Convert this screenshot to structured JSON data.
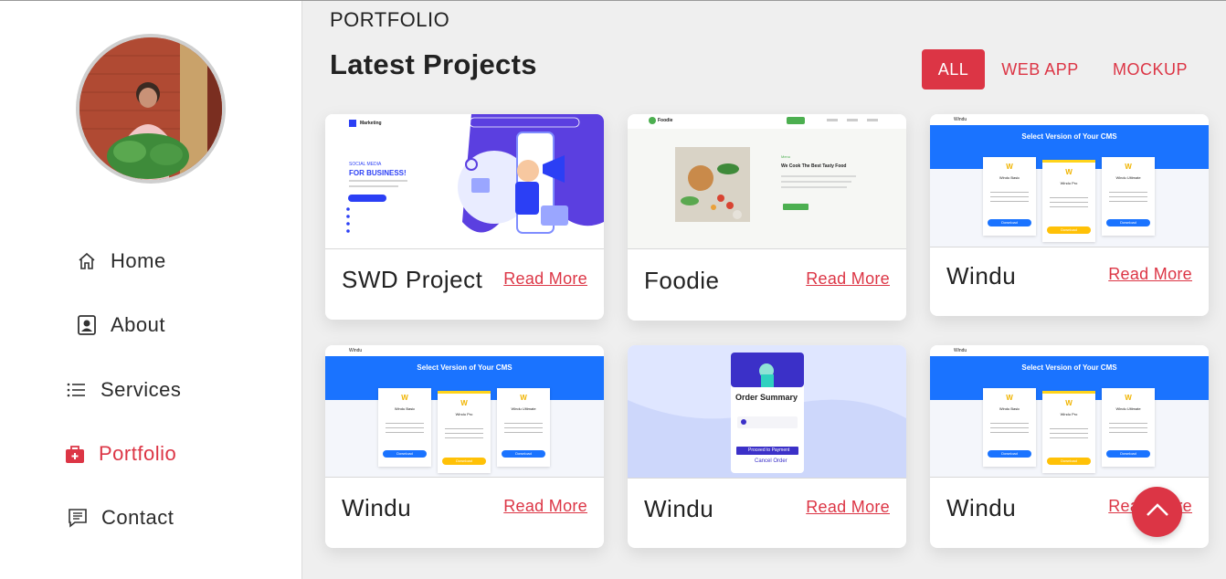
{
  "sidebar": {
    "items": [
      {
        "label": "Home",
        "icon": "home-icon",
        "active": false
      },
      {
        "label": "About",
        "icon": "person-badge-icon",
        "active": false
      },
      {
        "label": "Services",
        "icon": "list-icon",
        "active": false
      },
      {
        "label": "Portfolio",
        "icon": "briefcase-icon",
        "active": true
      },
      {
        "label": "Contact",
        "icon": "message-icon",
        "active": false
      }
    ]
  },
  "header": {
    "kicker": "PORTFOLIO",
    "title": "Latest Projects"
  },
  "filters": [
    "ALL",
    "WEB APP",
    "MOCKUP"
  ],
  "projects": [
    {
      "title": "SWD Project",
      "link": "Read More"
    },
    {
      "title": "Foodie",
      "link": "Read More"
    },
    {
      "title": "Windu",
      "link": "Read More"
    },
    {
      "title": "Windu",
      "link": "Read More"
    },
    {
      "title": "Windu",
      "link": "Read More"
    },
    {
      "title": "Windu",
      "link": "Read More"
    }
  ],
  "thumbs": {
    "marketing": {
      "brand": "Marketing",
      "kicker": "SOCIAL MEDIA",
      "headline": "FOR BUSINESS!"
    },
    "foodie": {
      "brand": "Foodie",
      "kicker": "Menu",
      "headline": "We Cook The Best Tasty Food"
    },
    "windu": {
      "brand": "Windu",
      "headline": "Select Version of Your CMS",
      "tiers": [
        "Windu Basic",
        "Windu Pro",
        "Windu Ultimate"
      ],
      "button": "Download"
    },
    "order": {
      "headline": "Order Summary",
      "button": "Proceed to Payment",
      "cancel": "Cancel Order"
    }
  },
  "colors": {
    "accent": "#dc3545",
    "windu_blue": "#1a73ff"
  }
}
